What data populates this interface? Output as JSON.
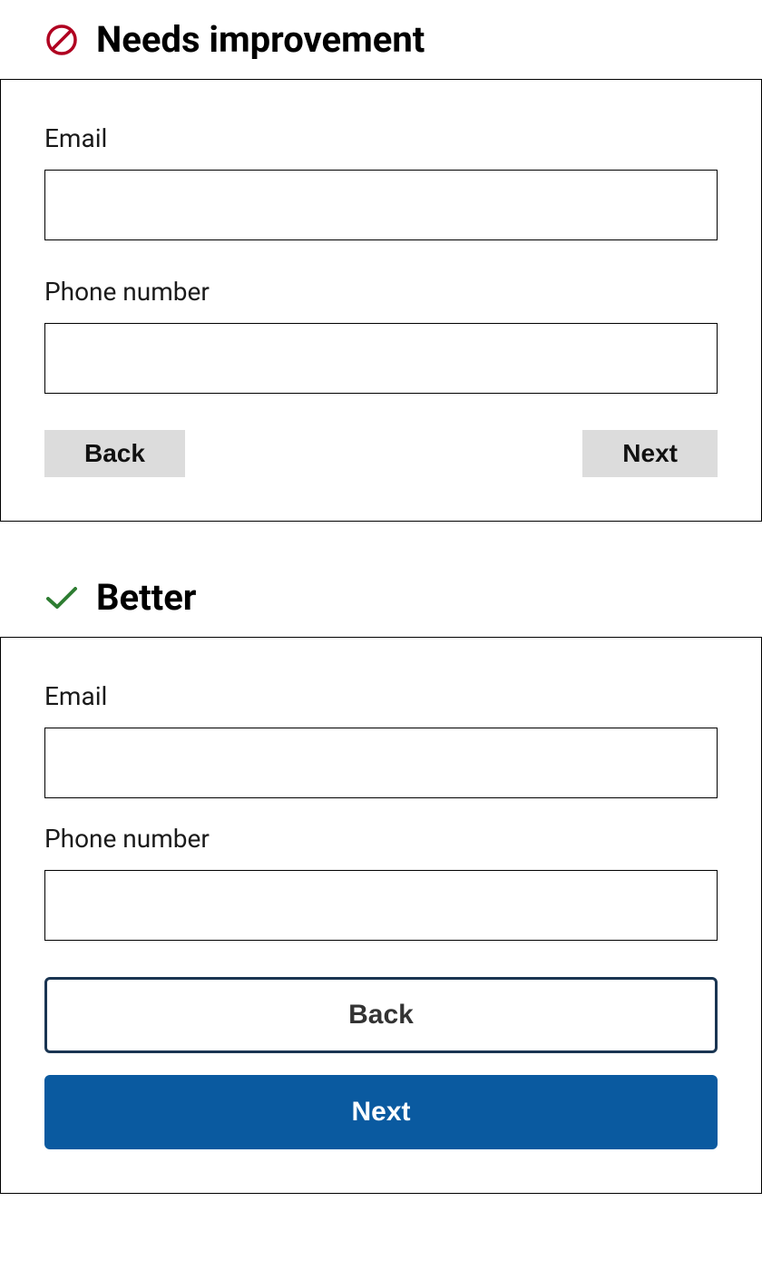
{
  "bad": {
    "title": "Needs improvement",
    "email_label": "Email",
    "phone_label": "Phone number",
    "back_label": "Back",
    "next_label": "Next"
  },
  "good": {
    "title": "Better",
    "email_label": "Email",
    "phone_label": "Phone number",
    "back_label": "Back",
    "next_label": "Next"
  }
}
